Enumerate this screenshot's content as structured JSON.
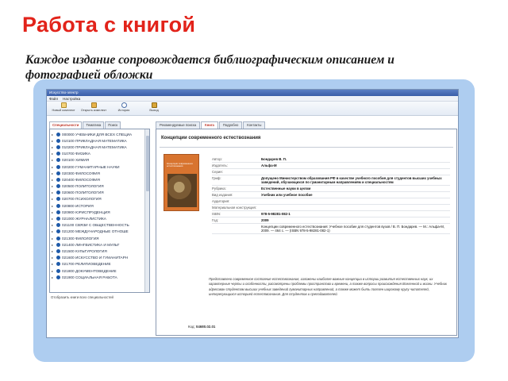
{
  "slide": {
    "title": "Работа с книгой",
    "subtitle": "Каждое издание сопровождается библиографическим описанием и фотографией обложки"
  },
  "window": {
    "title": "Искусство-электр",
    "menu": [
      "Файл",
      "Настройка"
    ],
    "toolbar": [
      {
        "label": "Новый комплект",
        "icon": "new-icon"
      },
      {
        "label": "Открыть комплект",
        "icon": "open-icon"
      },
      {
        "label": "История",
        "icon": "history-icon"
      },
      {
        "label": "Выход",
        "icon": "exit-icon"
      }
    ]
  },
  "left_panel": {
    "tabs": [
      "Специальности",
      "Тематика",
      "Поиск"
    ],
    "active_tab": 0,
    "tree": [
      "000000 УЧЕБНИКИ ДЛЯ ВСЕХ СПЕЦИА",
      "010100 ПРИКЛАДНАЯ МАТЕМАТИКА",
      "010200 ПРИКЛАДНАЯ МАТЕМАТИКА",
      "010700 ФИЗИКА",
      "020100 ХИМИЯ",
      "020200 ГУМАНИТАРНЫЕ НАУКИ",
      "020300 ФИЛОСОФИЯ",
      "020400 ФИЛОСОФИЯ",
      "020500 ПОЛИТОЛОГИЯ",
      "020600 ПОЛИТОЛОГИЯ",
      "020700 ПСИХОЛОГИЯ",
      "020800 ИСТОРИЯ",
      "020900 ЮРИСПРУДЕНЦИЯ",
      "021000 ЖУРНАЛИСТИКА",
      "021100 СВЯЗИ С ОБЩЕСТВЕННОСТЬ",
      "021200 МЕЖДУНАРОДНЫЕ ОТНОШЕ",
      "021300 ФИЛОЛОГИЯ",
      "021400 ЛИНГВИСТИКА И МУЛЬТ",
      "021500 КУЛЬТУРОЛОГИЯ",
      "021600 ИСКУССТВО И ГУМАНИТАРН",
      "021700 РЕЛИГИОВЕДЕНИЕ",
      "021800 ДОКУМЕНТОВЕДЕНИЕ",
      "021900 СОЦИАЛЬНАЯ РАБОТА"
    ],
    "footer": "Отобразить книги всех специальностей"
  },
  "right_panel": {
    "tabs": [
      "Рекомендуемые поиска",
      "Книга",
      "Подробно",
      "Контакты"
    ],
    "active_tab": 1,
    "title": "Концепции современного естествознания",
    "cover_text": "Концепции современного естествознания",
    "meta": [
      {
        "label": "Автор:",
        "value": "Бондарев В. П."
      },
      {
        "label": "Издатель:",
        "value": "Альфа-М"
      },
      {
        "label": "Серия:",
        "value": ""
      },
      {
        "label": "Гриф:",
        "value": "Допущено Министерством образования РФ в качестве учебного пособия для студентов высших учебных заведений, обучающихся по гуманитарным направлениям и специальностям"
      },
      {
        "label": "Рубрика:",
        "value": "Естественные науки в целом"
      },
      {
        "label": "Вид издания:",
        "value": "Учебник или учебное пособие"
      },
      {
        "label": "Аудитория:",
        "value": ""
      },
      {
        "label": "Материальная конструкция:",
        "value": ""
      },
      {
        "label": "ISBN:",
        "value": "978-5-98281-082-1"
      },
      {
        "label": "Год:",
        "value": "2009"
      },
      {
        "label": "",
        "value": "Концепции современного естествознания: Учебное пособие для студентов вузов / В. П. Бондарев. — М.: Альфа-М, 2009. — 464 с. — (ISBN 978-5-98281-082-1)"
      }
    ],
    "annotation": "Представлено современное состояние естествознания, изложены наиболее важные концепции в истории развития естественных наук, их характерные черты и особенности, рассмотрены проблемы пространства и времени, а также вопросы происхождения Вселенной и жизни. Учебник адресован студентам высших учебных заведений гуманитарных направлений, а также может быть полезен широкому кругу читателей, интересующихся историей естествознания. Для студентов и преподавателей.",
    "code_label": "Код:",
    "code_value": "04680.02.01"
  },
  "colors": {
    "title_red": "#e2231a",
    "frame": "#aecdf0",
    "tree_icon": "#1f5aa8",
    "cover": "#d8742f"
  }
}
